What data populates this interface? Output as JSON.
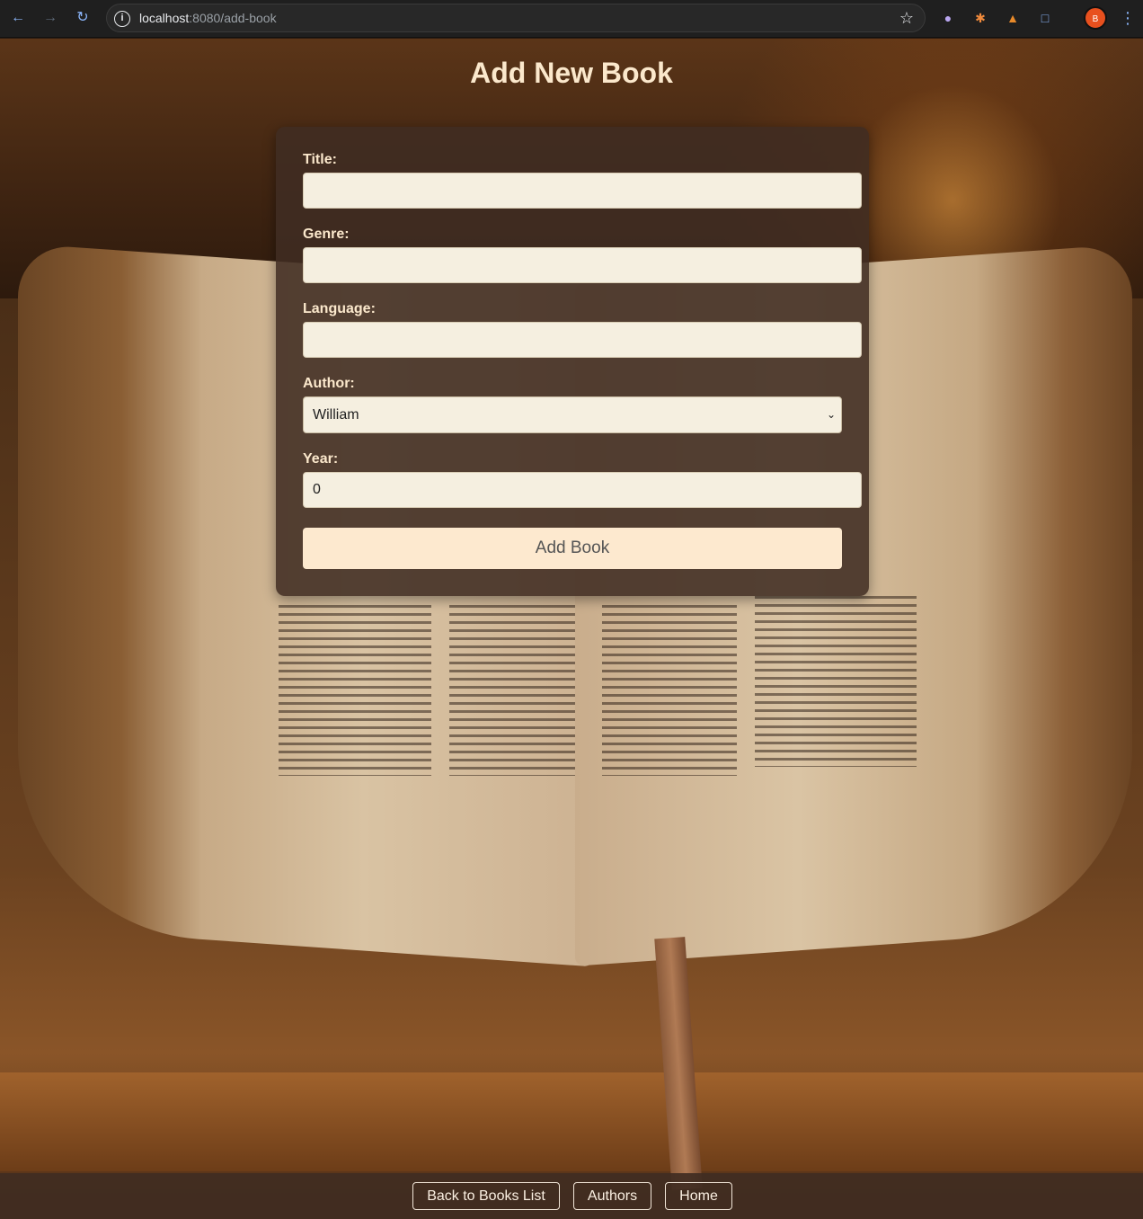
{
  "browser": {
    "url_host": "localhost",
    "url_path": ":8080/add-book",
    "profile_initial": "B",
    "icons": {
      "back": "arrow-left-icon",
      "forward": "arrow-right-icon",
      "reload": "reload-icon",
      "site_info": "info-icon",
      "bookmark": "star-icon",
      "menu": "kebab-menu-icon"
    }
  },
  "page": {
    "title": "Add New Book"
  },
  "form": {
    "title_label": "Title:",
    "title_value": "",
    "genre_label": "Genre:",
    "genre_value": "",
    "language_label": "Language:",
    "language_value": "",
    "author_label": "Author:",
    "author_selected": "William",
    "year_label": "Year:",
    "year_value": "0",
    "submit_label": "Add Book"
  },
  "footer": {
    "back_label": "Back to Books List",
    "authors_label": "Authors",
    "home_label": "Home"
  },
  "colors": {
    "accent_text": "#fbe8cc",
    "card_bg": "#402c22",
    "input_bg": "#f5efe0",
    "button_bg": "#fde9cf"
  }
}
